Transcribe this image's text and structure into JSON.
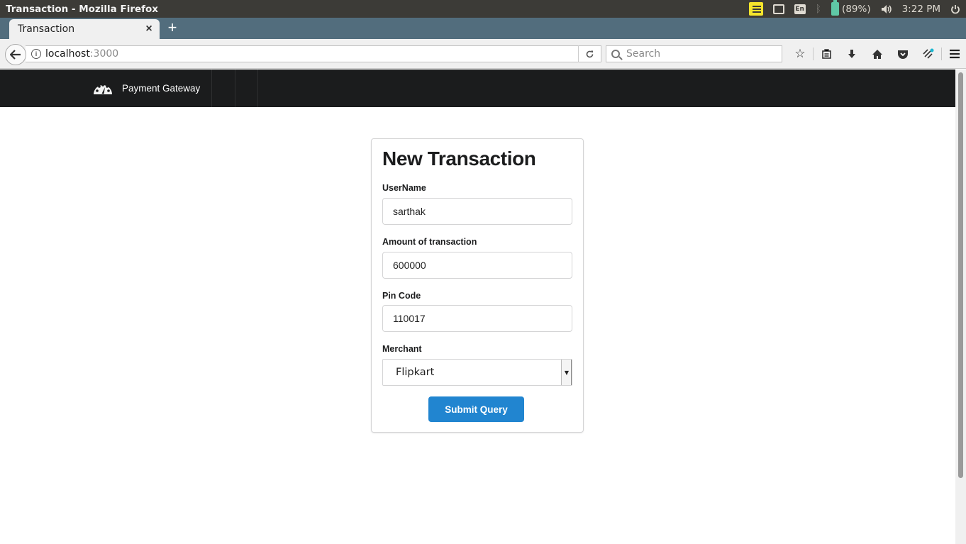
{
  "os": {
    "window_title": "Transaction - Mozilla Firefox",
    "battery": "(89%)",
    "time": "3:22 PM",
    "lang": "En"
  },
  "browser": {
    "tab_title": "Transaction",
    "url_host": "localhost",
    "url_port": ":3000",
    "search_placeholder": "Search"
  },
  "app": {
    "brand": "Payment Gateway"
  },
  "form": {
    "title": "New Transaction",
    "username_label": "UserName",
    "username_value": "sarthak",
    "amount_label": "Amount of transaction",
    "amount_value": "600000",
    "pin_label": "Pin Code",
    "pin_value": "110017",
    "merchant_label": "Merchant",
    "merchant_value": "Flipkart",
    "submit_label": "Submit Query"
  },
  "colors": {
    "primary_button": "#2185d0",
    "navbar": "#1b1c1d",
    "tab_strip": "#526d7d"
  }
}
